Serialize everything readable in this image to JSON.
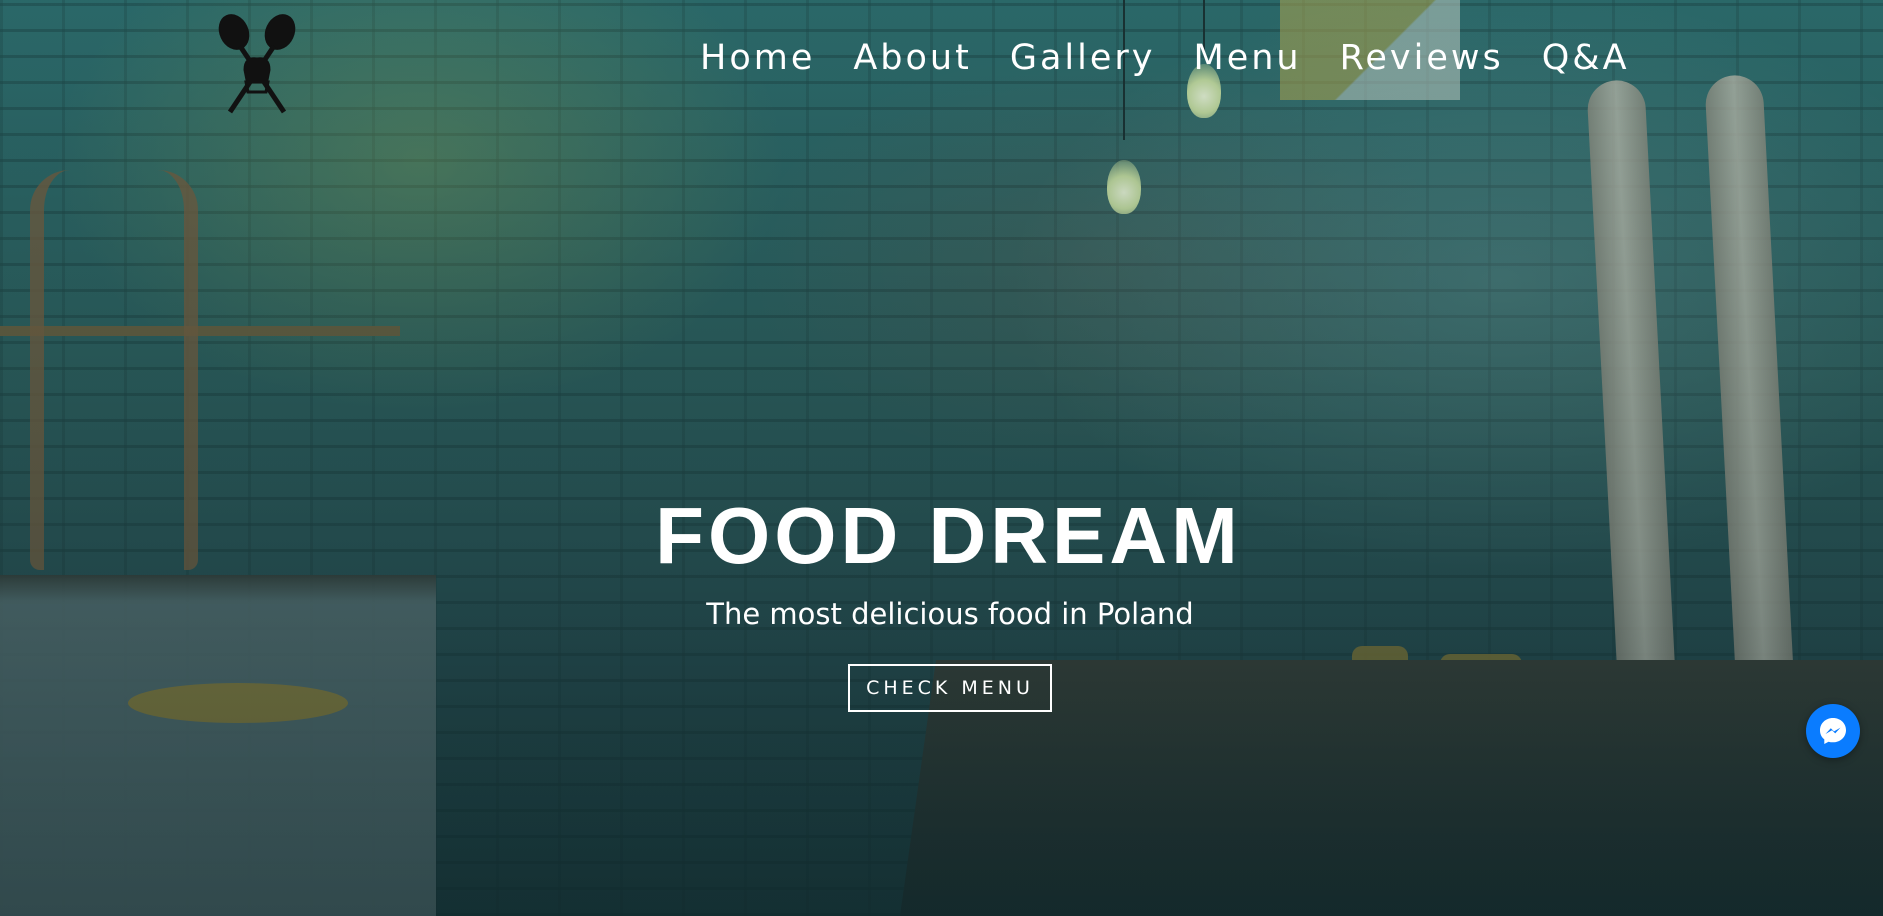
{
  "header": {
    "logo_icon": "crossed-spoons-chef-hat-icon",
    "nav": [
      {
        "label": "Home"
      },
      {
        "label": "About"
      },
      {
        "label": "Gallery"
      },
      {
        "label": "Menu"
      },
      {
        "label": "Reviews"
      },
      {
        "label": "Q&A"
      }
    ]
  },
  "hero": {
    "title": "FOOD DREAM",
    "subtitle": "The most delicious food in Poland",
    "cta_label": "CHECK MENU"
  },
  "chat_widget": {
    "icon": "messenger-icon",
    "color": "#0a7cff"
  },
  "theme": {
    "overlay_color": "#1f5e60",
    "text_color": "#ffffff"
  }
}
